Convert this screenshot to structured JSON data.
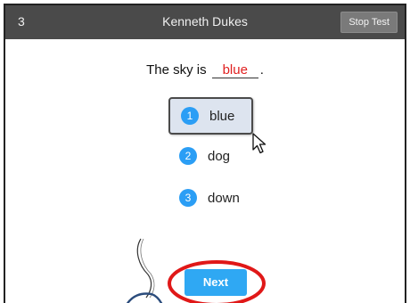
{
  "header": {
    "question_number": "3",
    "student_name": "Kenneth Dukes",
    "stop_label": "Stop Test"
  },
  "prompt": {
    "before": "The sky is",
    "answer": "blue",
    "after": "."
  },
  "choices": [
    {
      "number": "1",
      "label": "blue",
      "selected": true
    },
    {
      "number": "2",
      "label": "dog",
      "selected": false
    },
    {
      "number": "3",
      "label": "down",
      "selected": false
    }
  ],
  "next_label": "Next",
  "colors": {
    "header_bg": "#4a4a4a",
    "accent_blue": "#2fa8f3",
    "answer_red": "#e02020",
    "annotation_red": "#e01818",
    "selected_bg": "#dde4ef"
  },
  "icons": [
    "mouse-pointer-icon"
  ]
}
